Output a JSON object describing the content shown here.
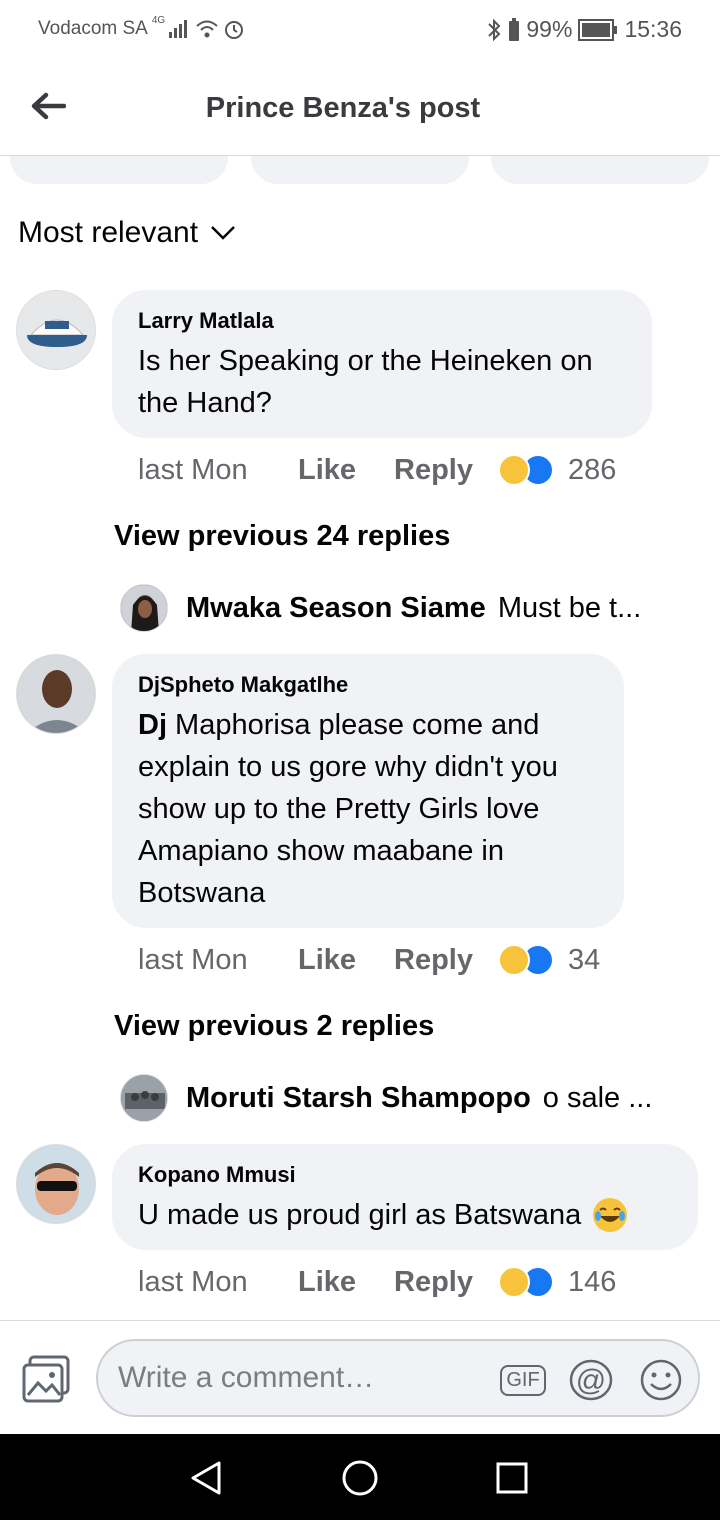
{
  "statusbar": {
    "carrier": "Vodacom SA",
    "network": "4G",
    "battery": "99%",
    "time": "15:36"
  },
  "header": {
    "title": "Prince Benza's post",
    "back_icon": "arrow-left-icon"
  },
  "sort": {
    "label": "Most relevant",
    "icon": "chevron-down-icon"
  },
  "comments": [
    {
      "author": "Larry Matlala",
      "text": "Is her Speaking or the Heineken on the Hand?",
      "time": "last Mon",
      "like": "Like",
      "reply": "Reply",
      "reactions": "286",
      "view_previous": "View previous 24 replies",
      "latest_reply": {
        "author": "Mwaka Season Siame",
        "text": "Must be t..."
      }
    },
    {
      "author": "DjSpheto Makgatlhe",
      "text_bold": "Dj",
      "text": " Maphorisa please come and explain to us gore why didn't you show up to the Pretty Girls love Amapiano show maabane in Botswana",
      "time": "last Mon",
      "like": "Like",
      "reply": "Reply",
      "reactions": "34",
      "view_previous": "View previous 2 replies",
      "latest_reply": {
        "author": "Moruti Starsh Shampopo",
        "text": "o sale ..."
      }
    },
    {
      "author": "Kopano Mmusi",
      "text": "U made us proud girl as Batswana",
      "time": "last Mon",
      "like": "Like",
      "reply": "Reply",
      "reactions": "146"
    }
  ],
  "composer": {
    "placeholder": "Write a comment…",
    "gif_label": "GIF"
  },
  "colors": {
    "bubble_bg": "#f0f2f5",
    "secondary_text": "#65676b",
    "like_blue": "#1877f2",
    "haha_yellow": "#f7c33a"
  }
}
